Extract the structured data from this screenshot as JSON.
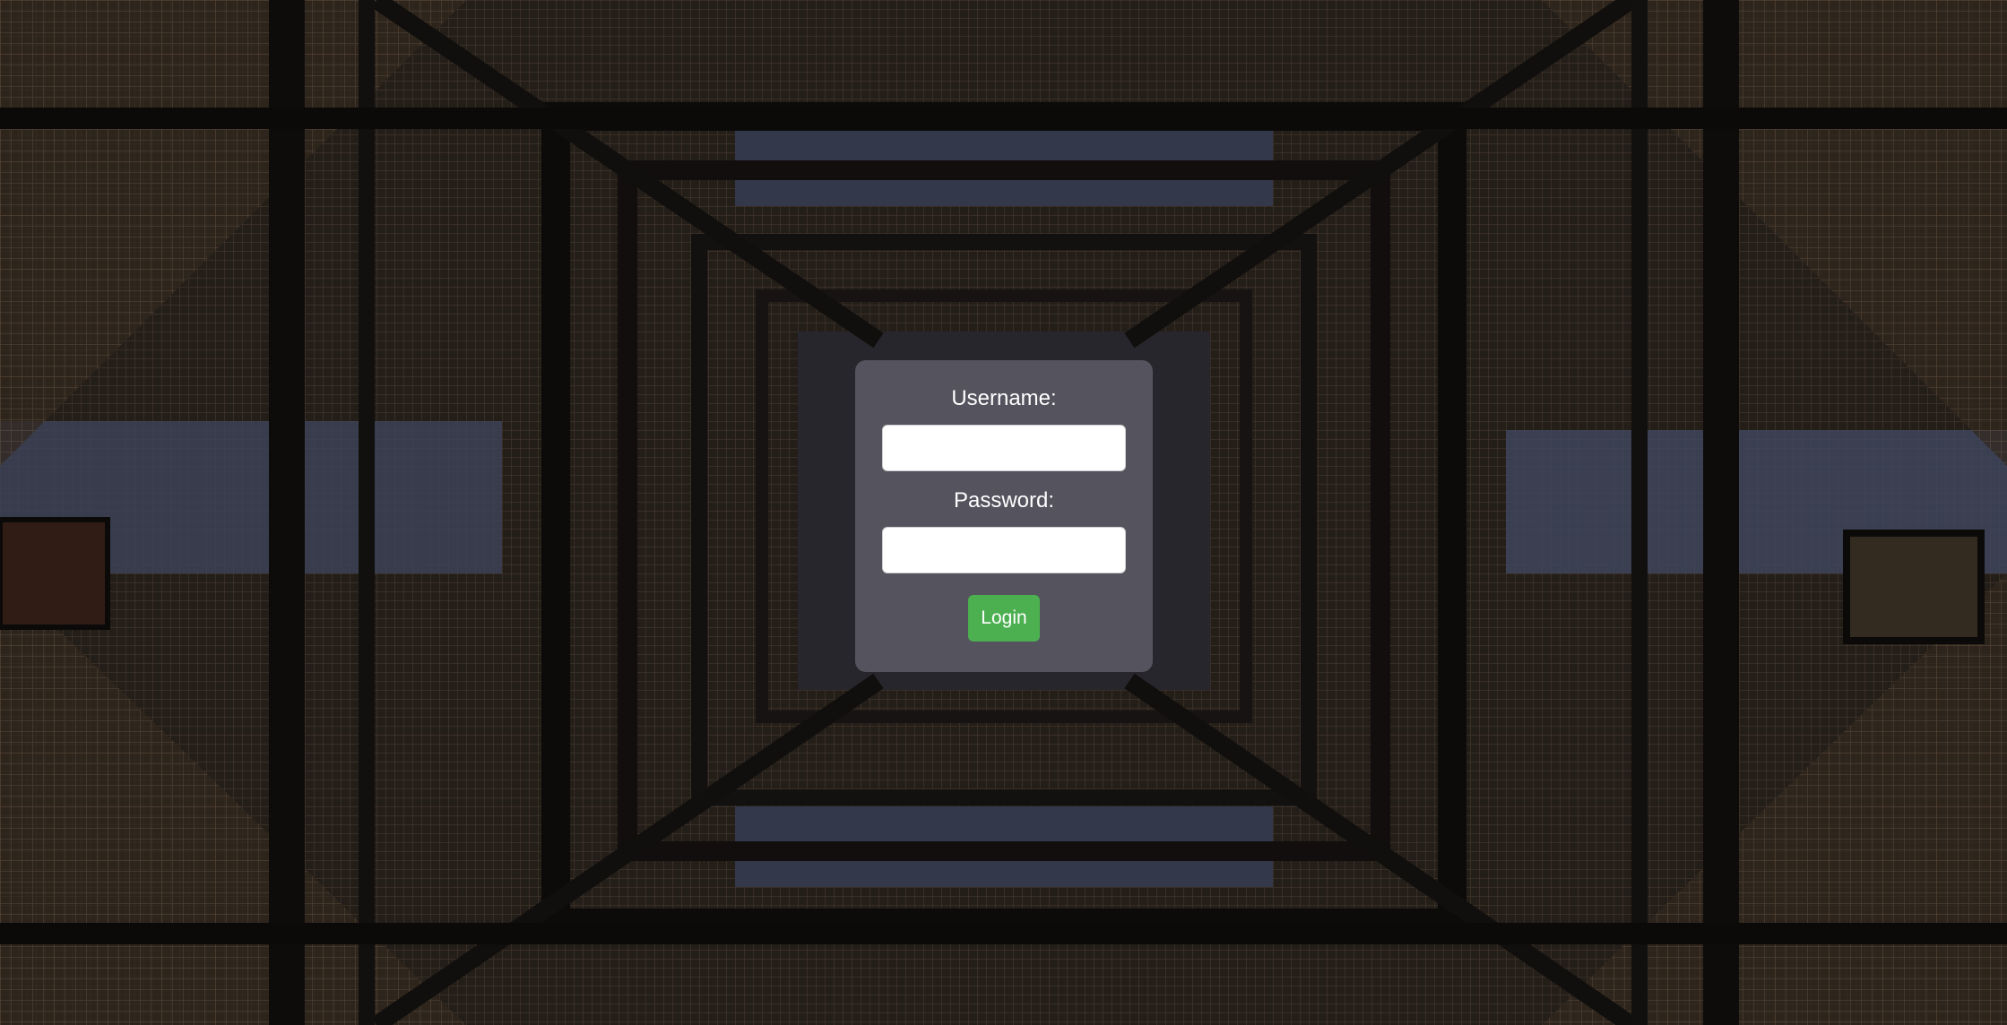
{
  "login": {
    "username_label": "Username:",
    "username_value": "",
    "password_label": "Password:",
    "password_value": "",
    "login_button": "Login"
  },
  "colors": {
    "button_green": "#4caf50",
    "panel_overlay": "#787887"
  },
  "background": {
    "description_icon": "steel-tower-background-image"
  }
}
